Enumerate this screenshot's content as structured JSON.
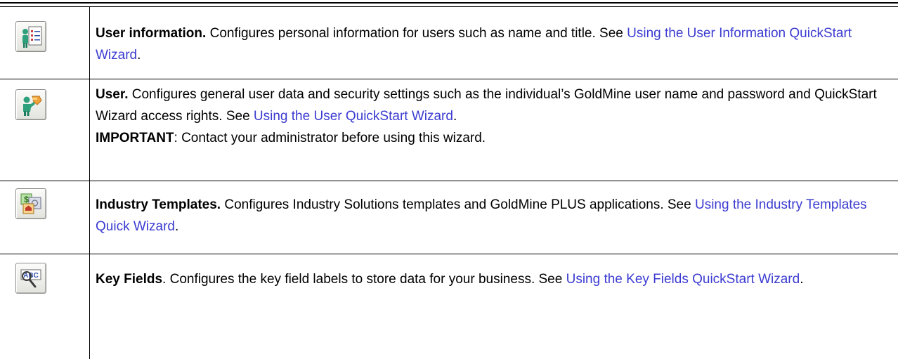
{
  "rows": [
    {
      "icon": "user-info-icon",
      "title": "User information.",
      "desc": " Configures personal information for users such as name and title. See ",
      "link": "Using the User Information QuickStart Wizard",
      "end": "."
    },
    {
      "icon": "user-key-icon",
      "title": "User.",
      "desc": " Configures general user data and security settings such as the individual’s GoldMine user name and password and QuickStart Wizard access rights. See ",
      "link": "Using the User QuickStart Wizard",
      "end": ".",
      "important_label": "IMPORTANT",
      "important_text": ": Contact your administrator before using this wizard."
    },
    {
      "icon": "industry-templates-icon",
      "title": "Industry Templates.",
      "desc": " Configures Industry Solutions templates and GoldMine PLUS applications. See ",
      "link": "Using the Industry Templates Quick Wizard",
      "end": "."
    },
    {
      "icon": "key-fields-icon",
      "title": "Key Fields",
      "desc": ". Configures the key field labels to store data for your business. See ",
      "link": "Using the Key Fields QuickStart Wizard",
      "end": ".",
      "icon_text": "ABC"
    }
  ],
  "colors": {
    "link": "#3b3bd1",
    "rule": "#000000"
  }
}
